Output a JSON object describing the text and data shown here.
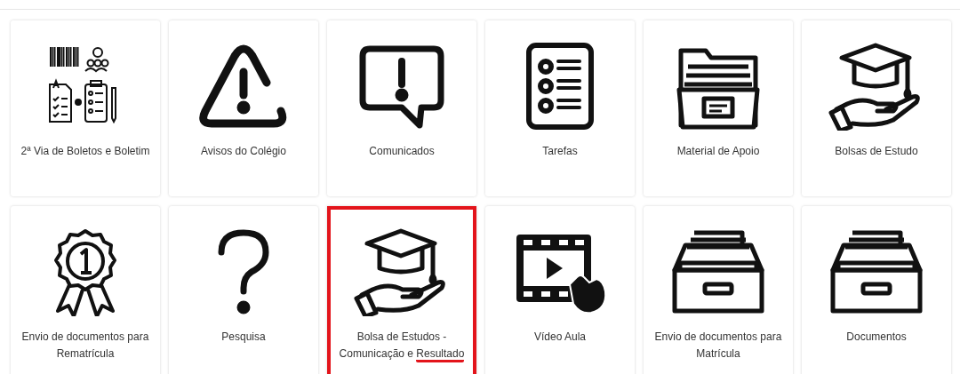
{
  "tiles": [
    {
      "kind": "documents",
      "label": "2ª Via de Boletos e Boletim",
      "highlighted": false,
      "underline": false
    },
    {
      "kind": "warning",
      "label": "Avisos do Colégio",
      "highlighted": false,
      "underline": false
    },
    {
      "kind": "message",
      "label": "Comunicados",
      "highlighted": false,
      "underline": false
    },
    {
      "kind": "checklist",
      "label": "Tarefas",
      "highlighted": false,
      "underline": false
    },
    {
      "kind": "folder",
      "label": "Material de Apoio",
      "highlighted": false,
      "underline": false
    },
    {
      "kind": "scholarship",
      "label": "Bolsas de Estudo",
      "highlighted": false,
      "underline": false
    },
    {
      "kind": "medal",
      "label": "Envio de documentos para Rematrícula",
      "highlighted": false,
      "underline": false
    },
    {
      "kind": "question",
      "label": "Pesquisa",
      "highlighted": false,
      "underline": false
    },
    {
      "kind": "scholarship",
      "label": "Bolsa de Estudos - Comunicação e Resultado",
      "highlighted": true,
      "underline": true
    },
    {
      "kind": "video",
      "label": "Vídeo Aula",
      "highlighted": false,
      "underline": false
    },
    {
      "kind": "drawer",
      "label": "Envio de documentos para Matrícula",
      "highlighted": false,
      "underline": false
    },
    {
      "kind": "drawer",
      "label": "Documentos",
      "highlighted": false,
      "underline": false
    }
  ]
}
